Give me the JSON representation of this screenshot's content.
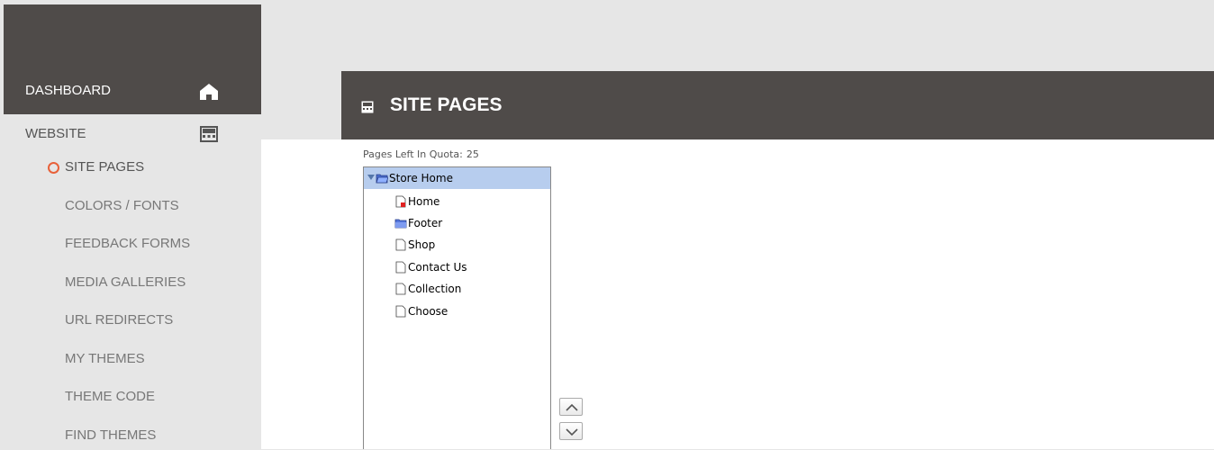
{
  "sidebar": {
    "dashboard_label": "DASHBOARD",
    "website_label": "WEBSITE",
    "items": [
      {
        "label": "SITE PAGES",
        "active": true
      },
      {
        "label": "COLORS / FONTS"
      },
      {
        "label": "FEEDBACK FORMS"
      },
      {
        "label": "MEDIA GALLERIES"
      },
      {
        "label": "URL REDIRECTS"
      },
      {
        "label": "MY THEMES"
      },
      {
        "label": "THEME CODE"
      },
      {
        "label": "FIND THEMES"
      }
    ]
  },
  "header": {
    "title": "SITE PAGES"
  },
  "quota": {
    "label": "Pages Left In Quota:",
    "value": "25"
  },
  "tree": {
    "root": "Store Home",
    "children": [
      {
        "label": "Home",
        "icon": "page-home-icon"
      },
      {
        "label": "Footer",
        "icon": "folder-icon"
      },
      {
        "label": "Shop",
        "icon": "page-icon"
      },
      {
        "label": "Contact Us",
        "icon": "page-icon"
      },
      {
        "label": "Collection",
        "icon": "page-icon"
      },
      {
        "label": "Choose",
        "icon": "page-icon"
      }
    ]
  },
  "colors": {
    "sidebar_dark": "#4f4b49",
    "accent": "#e8613a",
    "tree_selection": "#b7cdee"
  }
}
